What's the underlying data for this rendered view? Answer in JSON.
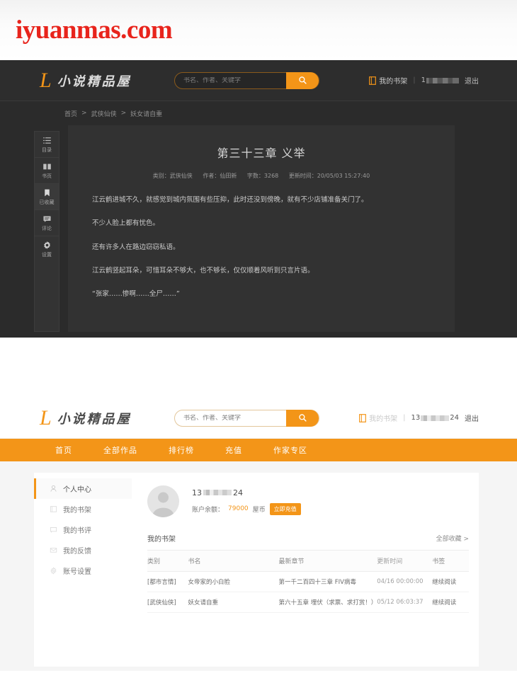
{
  "watermark": {
    "text": "iyuanmas.com",
    "color": "#e8241c"
  },
  "brand": {
    "mark": "L",
    "name": "小说精品屋",
    "accent": "#f39518"
  },
  "reader": {
    "search": {
      "placeholder": "书名、作者、关键字",
      "value": "",
      "icon": "search-icon"
    },
    "header_links": {
      "shelf_icon": "book-icon",
      "shelf_label": "我的书架",
      "separator": "|",
      "username_prefix": "1",
      "username_suffix": "",
      "logout_label": "退出"
    },
    "breadcrumb": {
      "home": "首页",
      "sep1": ">",
      "category": "武侠仙侠",
      "sep2": ">",
      "book": "妖女请自重"
    },
    "tools": [
      {
        "icon": "list-icon",
        "label": "目录"
      },
      {
        "icon": "book-open-icon",
        "label": "书页"
      },
      {
        "icon": "bookmark-icon",
        "label": "已收藏",
        "active": true
      },
      {
        "icon": "comment-icon",
        "label": "评论"
      },
      {
        "icon": "gear-icon",
        "label": "设置"
      }
    ],
    "chapter": {
      "title": "第三十三章 义举",
      "meta": {
        "category_label": "类别：武侠仙侠",
        "author_label": "作者：仙田新",
        "wordcount_label": "字数：3268",
        "updated_label": "更新时间：20/05/03 15:27:40"
      },
      "paragraphs": [
        "江云鹤进城不久，就感觉到城内氛围有些压抑，此时还没到傍晚，就有不少店铺准备关门了。",
        "不少人脸上都有忧色。",
        "还有许多人在路边窃窃私语。",
        "江云鹤竖起耳朵，可惜耳朵不够大，也不够长，仅仅顺着风听到只言片语。",
        "“张家……惨啊……全尸……”"
      ]
    }
  },
  "user_center": {
    "search": {
      "placeholder": "书名、作者、关键字",
      "value": "",
      "icon": "search-icon"
    },
    "header_links": {
      "shelf_icon": "book-icon",
      "shelf_label": "我的书架",
      "separator": "|",
      "username_prefix": "13",
      "username_suffix": "24",
      "logout_label": "退出"
    },
    "nav": [
      {
        "label": "首页"
      },
      {
        "label": "全部作品"
      },
      {
        "label": "排行榜"
      },
      {
        "label": "充值"
      },
      {
        "label": "作家专区"
      }
    ],
    "sidebar": [
      {
        "icon": "user-icon",
        "label": "个人中心",
        "active": true
      },
      {
        "icon": "shelf-icon",
        "label": "我的书架"
      },
      {
        "icon": "review-icon",
        "label": "我的书评"
      },
      {
        "icon": "mail-icon",
        "label": "我的反馈"
      },
      {
        "icon": "gear-icon",
        "label": "账号设置"
      }
    ],
    "profile": {
      "avatar": "avatar-placeholder",
      "name_prefix": "13",
      "name_suffix": "24",
      "balance_label": "账户余额：",
      "balance_value": "79000",
      "balance_unit": "屋币",
      "recharge_label": "立即充值"
    },
    "shelf": {
      "title": "我的书架",
      "all_link": "全部收藏 >",
      "columns": [
        "类别",
        "书名",
        "最新章节",
        "更新时间",
        "书签"
      ],
      "rows": [
        {
          "category": "[都市言情]",
          "name": "女帝家的小白脸",
          "chapter": "第一千二百四十三章 FIV病毒",
          "updated": "04/16 00:00:00",
          "mark": "继续阅读"
        },
        {
          "category": "[武侠仙侠]",
          "name": "妖女请自重",
          "chapter": "第六十五章 埋伏（求票、求打赏！）",
          "updated": "05/12 06:03:37",
          "mark": "继续阅读"
        }
      ]
    }
  }
}
